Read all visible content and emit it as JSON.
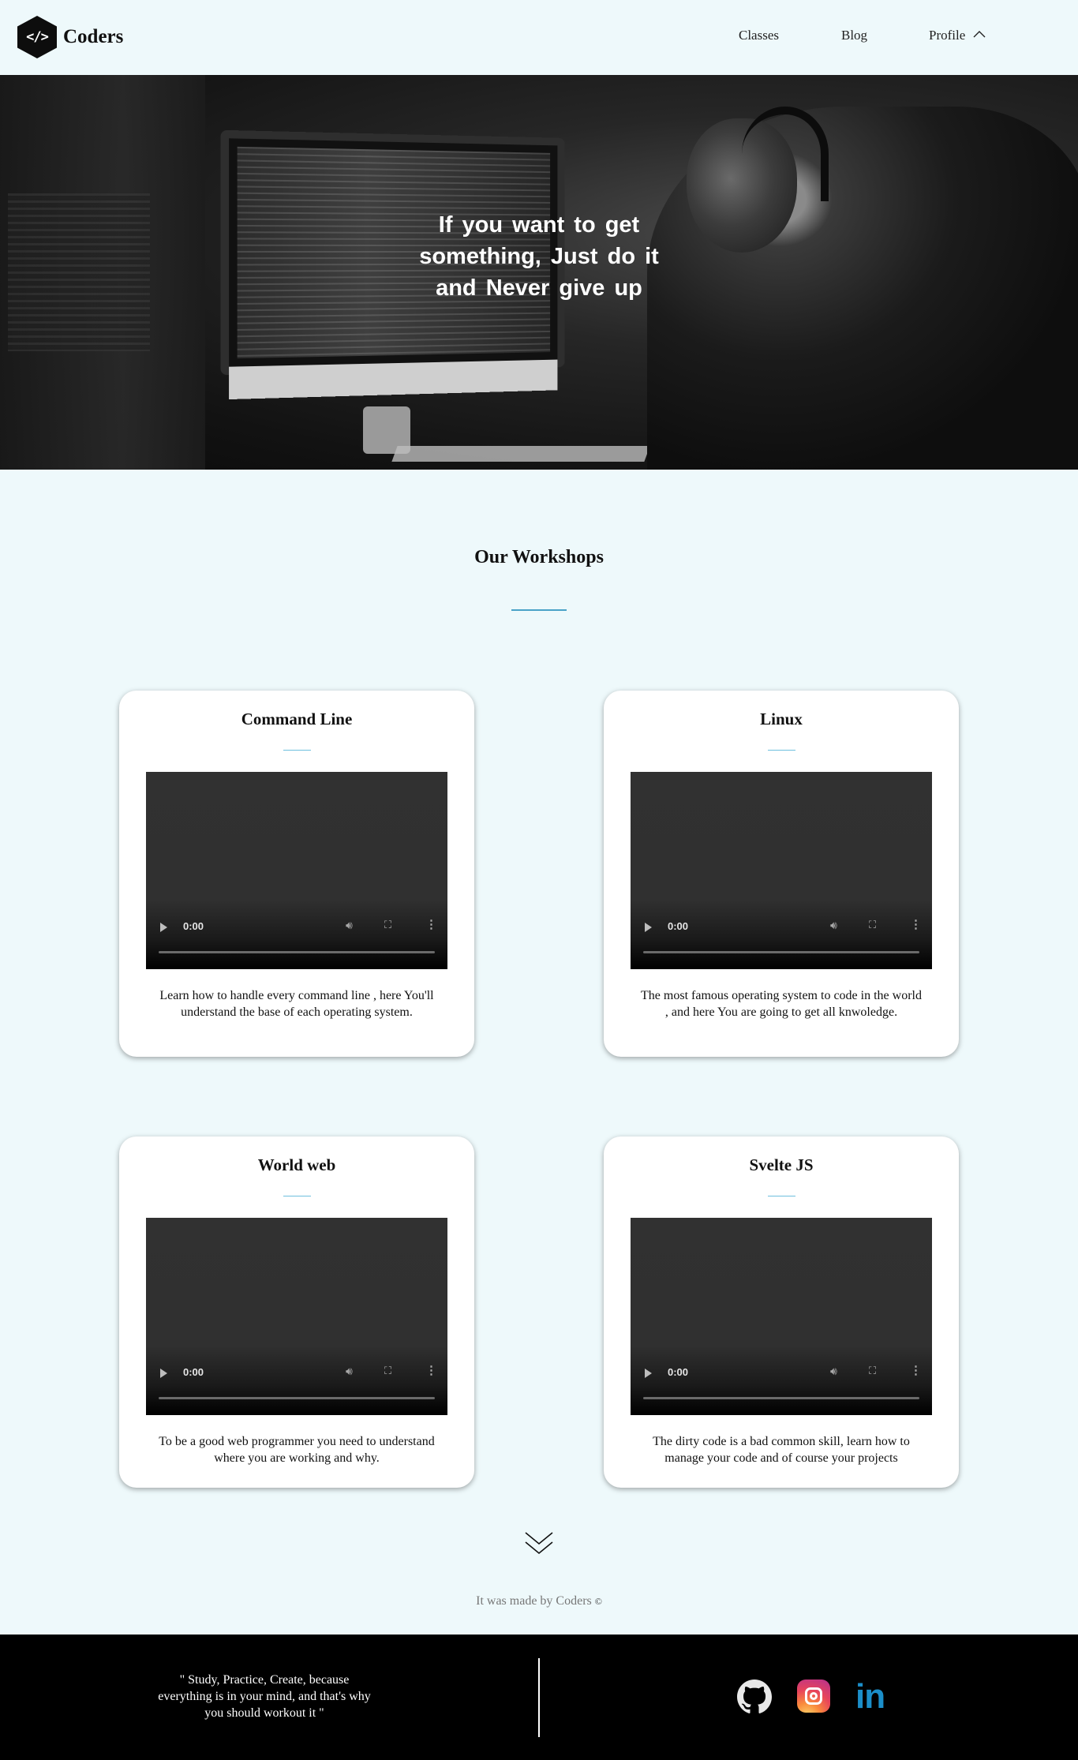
{
  "header": {
    "logo_glyph": "</>",
    "brand": "Coders",
    "nav": {
      "classes": "Classes",
      "blog": "Blog",
      "profile": "Profile"
    }
  },
  "hero": {
    "quote": "If you want to get something, Just do it and Never give up"
  },
  "workshops": {
    "title": "Our Workshops",
    "accent_color": "#4aa3c8",
    "cards": [
      {
        "title": "Command Line",
        "time": "0:00",
        "description": "Learn how to handle every command line , here You'll understand the base of each operating system."
      },
      {
        "title": "Linux",
        "time": "0:00",
        "description": "The most famous operating system to code in the world , and here You are going to get all knwoledge."
      },
      {
        "title": "World web",
        "time": "0:00",
        "description": "To be a good web programmer you need to understand where you are working and why."
      },
      {
        "title": "Svelte JS",
        "time": "0:00",
        "description": "The dirty code is a bad common skill, learn how to manage your code and of course your projects"
      }
    ]
  },
  "made_by": {
    "text": "It was made by Coders",
    "mark": "©"
  },
  "footer": {
    "quote": "\" Study, Practice, Create, because everything is in your mind, and that's why you should workout it \"",
    "social": [
      "github-icon",
      "instagram-icon",
      "linkedin-icon"
    ],
    "linkedin_glyph": "in"
  }
}
